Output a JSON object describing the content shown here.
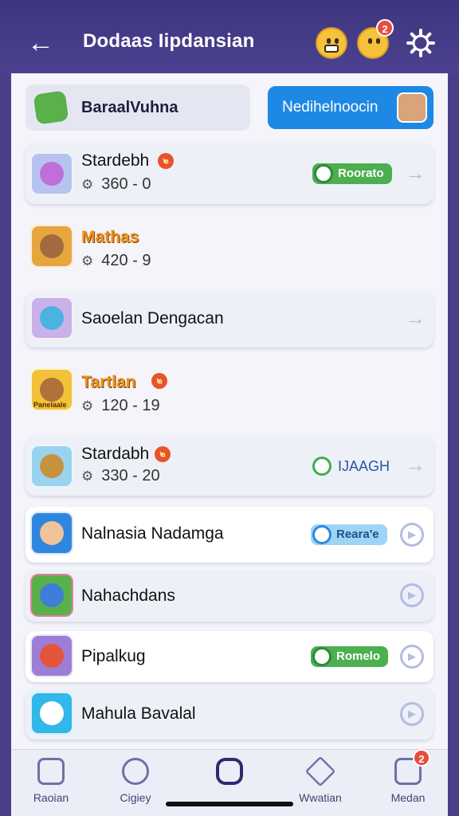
{
  "header": {
    "title": "Dodaas Iipdansian",
    "notification_count": "2"
  },
  "filters": {
    "left_label": "BaraalVuhna",
    "right_label": "Nedihelnoocin"
  },
  "items": [
    {
      "name": "Stardebh",
      "stat": "360 - 0",
      "badge": "๒",
      "action": "Roorato",
      "action_style": "green",
      "nav": "arrow"
    },
    {
      "name": "Mathas",
      "stat": "420 - 9",
      "action": "",
      "nav": ""
    },
    {
      "name": "Saoelan Dengacan",
      "stat": "",
      "action": "",
      "nav": "arrow"
    },
    {
      "name": "Tartlan",
      "stat": "120 - 19",
      "badge": "๒",
      "icon_caption": "Panelaale",
      "action": "",
      "nav": ""
    },
    {
      "name": "Stardabh",
      "stat": "330 - 20",
      "badge": "๒",
      "action": "IJAAGH",
      "action_style": "text",
      "nav": "arrow"
    },
    {
      "name": "Nalnasia Nadamga",
      "stat": "",
      "action": "Reara'e",
      "action_style": "blue",
      "nav": "circle"
    },
    {
      "name": "Nahachdans",
      "stat": "",
      "action": "",
      "nav": "circle"
    },
    {
      "name": "Pipalkug",
      "stat": "",
      "action": "Romelo",
      "action_style": "green",
      "nav": "circle"
    },
    {
      "name": "Mahula Bavalal",
      "stat": "",
      "action": "",
      "nav": "circle"
    }
  ],
  "tabs": [
    {
      "label": "Raoian",
      "icon": "home-icon"
    },
    {
      "label": "Cigiey",
      "icon": "chat-icon"
    },
    {
      "label": "",
      "icon": "center-app-icon"
    },
    {
      "label": "Wwatian",
      "icon": "star-icon"
    },
    {
      "label": "Medan",
      "icon": "profile-icon",
      "badge": "2"
    }
  ],
  "colors": {
    "header": "#3e3580",
    "accent_blue": "#1e88e5",
    "pill_green": "#4caf50",
    "badge_red": "#e74c3c"
  }
}
